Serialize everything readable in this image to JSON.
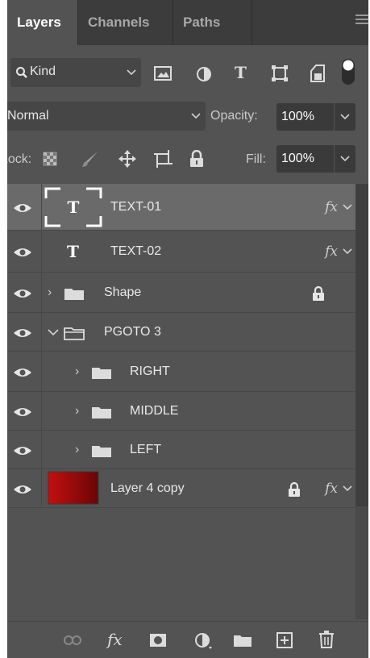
{
  "tabs": [
    {
      "label": "Layers",
      "active": true
    },
    {
      "label": "Channels",
      "active": false
    },
    {
      "label": "Paths",
      "active": false
    }
  ],
  "filter": {
    "label": "Kind"
  },
  "blend": {
    "mode": "Normal",
    "opacity_label": "Opacity:",
    "opacity_value": "100%"
  },
  "lock": {
    "label": "Lock:",
    "fill_label": "Fill:",
    "fill_value": "100%"
  },
  "layers": [
    {
      "name": "TEXT-01",
      "type": "text",
      "selected": true,
      "fx": "fx"
    },
    {
      "name": "TEXT-02",
      "type": "text",
      "selected": false,
      "fx": "fx"
    },
    {
      "name": "Shape",
      "type": "group",
      "expanded": false,
      "locked": true
    },
    {
      "name": "PGOTO 3",
      "type": "group",
      "expanded": true
    },
    {
      "name": "RIGHT",
      "type": "group",
      "expanded": false
    },
    {
      "name": "MIDDLE",
      "type": "group",
      "expanded": false
    },
    {
      "name": "LEFT",
      "type": "group",
      "expanded": false
    },
    {
      "name": "Layer 4 copy",
      "type": "image",
      "locked": true,
      "fx": "fx",
      "thumb_color": "#b10c0c"
    }
  ],
  "bottom": {
    "fx": "fx"
  },
  "colors": {
    "panel": "#535353",
    "tabbar": "#3c3c3c",
    "selected": "#6a6a6a"
  }
}
